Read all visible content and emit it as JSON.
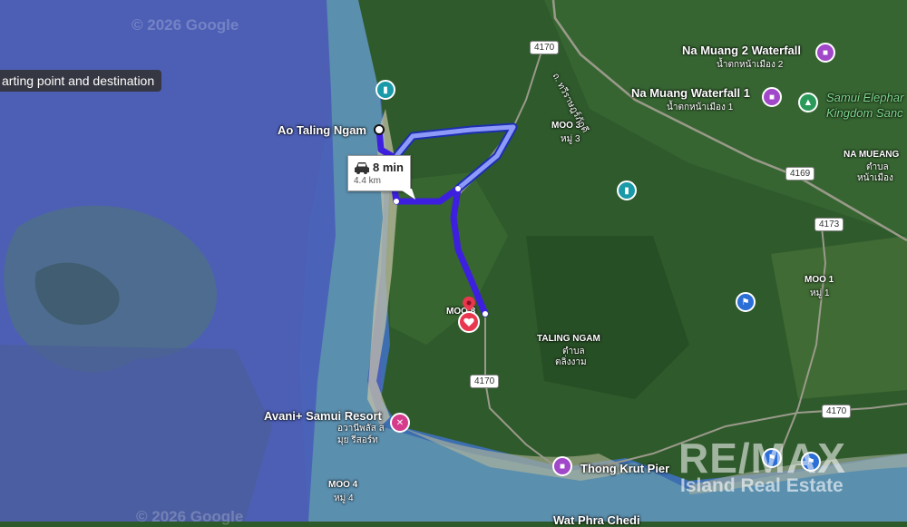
{
  "tooltip": "arting point and destination",
  "route": {
    "time": "8 min",
    "distance": "4.4 km"
  },
  "watermarks": [
    "© 2026 Google",
    "© 2026 Google"
  ],
  "places": {
    "ao_taling_ngam": "Ao Taling Ngam",
    "na_muang2": "Na Muang 2 Waterfall",
    "na_muang2_thai": "น้ำตกหน้าเมือง 2",
    "na_muang1": "Na Muang Waterfall 1",
    "na_muang1_thai": "น้ำตกหน้าเมือง 1",
    "elephant_line1": "Samui Elephar",
    "elephant_line2": "Kingdom Sanc",
    "moo3": "MOO 3",
    "moo3_thai": "หมู่ 3",
    "na_mueang": "NA MUEANG",
    "na_mueang_thai1": "ตำบล",
    "na_mueang_thai2": "หน้าเมือง",
    "moo1": "MOO 1",
    "moo1_thai": "หมู่ 1",
    "moo_pin": "MOO 8",
    "taling_ngam": "TALING NGAM",
    "taling_ngam_thai1": "ตำบล",
    "taling_ngam_thai2": "ตลิ่งงาม",
    "avani": "Avani+ Samui Resort",
    "avani_thai1": "อวานีพลัส ส",
    "avani_thai2": "มุย รีสอร์ท",
    "thong_krut": "Thong Krut Pier",
    "moo4": "MOO 4",
    "moo4_thai": "หมู่ 4",
    "wat": "Wat Phra Chedi",
    "road_thai": "ถ. ทวีราษฎร์ภักดี"
  },
  "shields": [
    "4170",
    "4169",
    "4173",
    "4170",
    "4170"
  ],
  "brand": {
    "name": "RE/MAX",
    "sub": "Island Real Estate"
  },
  "icons": [
    "camera-icon",
    "tree-icon",
    "bookmark-icon",
    "flag-icon",
    "hotel-icon",
    "heart-pin-icon",
    "car-icon"
  ],
  "colors": {
    "route_main": "#3d1fe0",
    "route_alt": "#7f8cf5",
    "pin": "#e8374f",
    "poi_purple": "#a147c9",
    "poi_teal": "#1a9aa8",
    "poi_blue": "#2b6fd6",
    "poi_pink": "#d63c8c"
  }
}
